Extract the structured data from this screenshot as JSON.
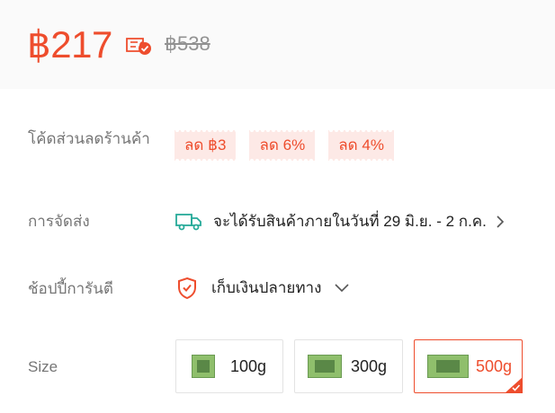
{
  "price": {
    "current": "฿217",
    "original": "฿538",
    "coupon_icon": "coupon-check-icon"
  },
  "vouchers": {
    "label": "โค้ดส่วนลดร้านค้า",
    "items": [
      "ลด ฿3",
      "ลด 6%",
      "ลด 4%"
    ]
  },
  "shipping": {
    "label": "การจัดส่ง",
    "text": "จะได้รับสินค้าภายในวันที่ 29 มิ.ย. - 2 ก.ค.",
    "icon": "truck-icon"
  },
  "guarantee": {
    "label": "ช้อปปี้การันตี",
    "text": "เก็บเงินปลายทาง",
    "icon": "shield-check-icon"
  },
  "size": {
    "label": "Size",
    "options": [
      "100g",
      "300g",
      "500g"
    ],
    "selected": "500g"
  },
  "colors": {
    "accent": "#ee4d2d",
    "teal": "#26aa99",
    "label": "#757575"
  }
}
